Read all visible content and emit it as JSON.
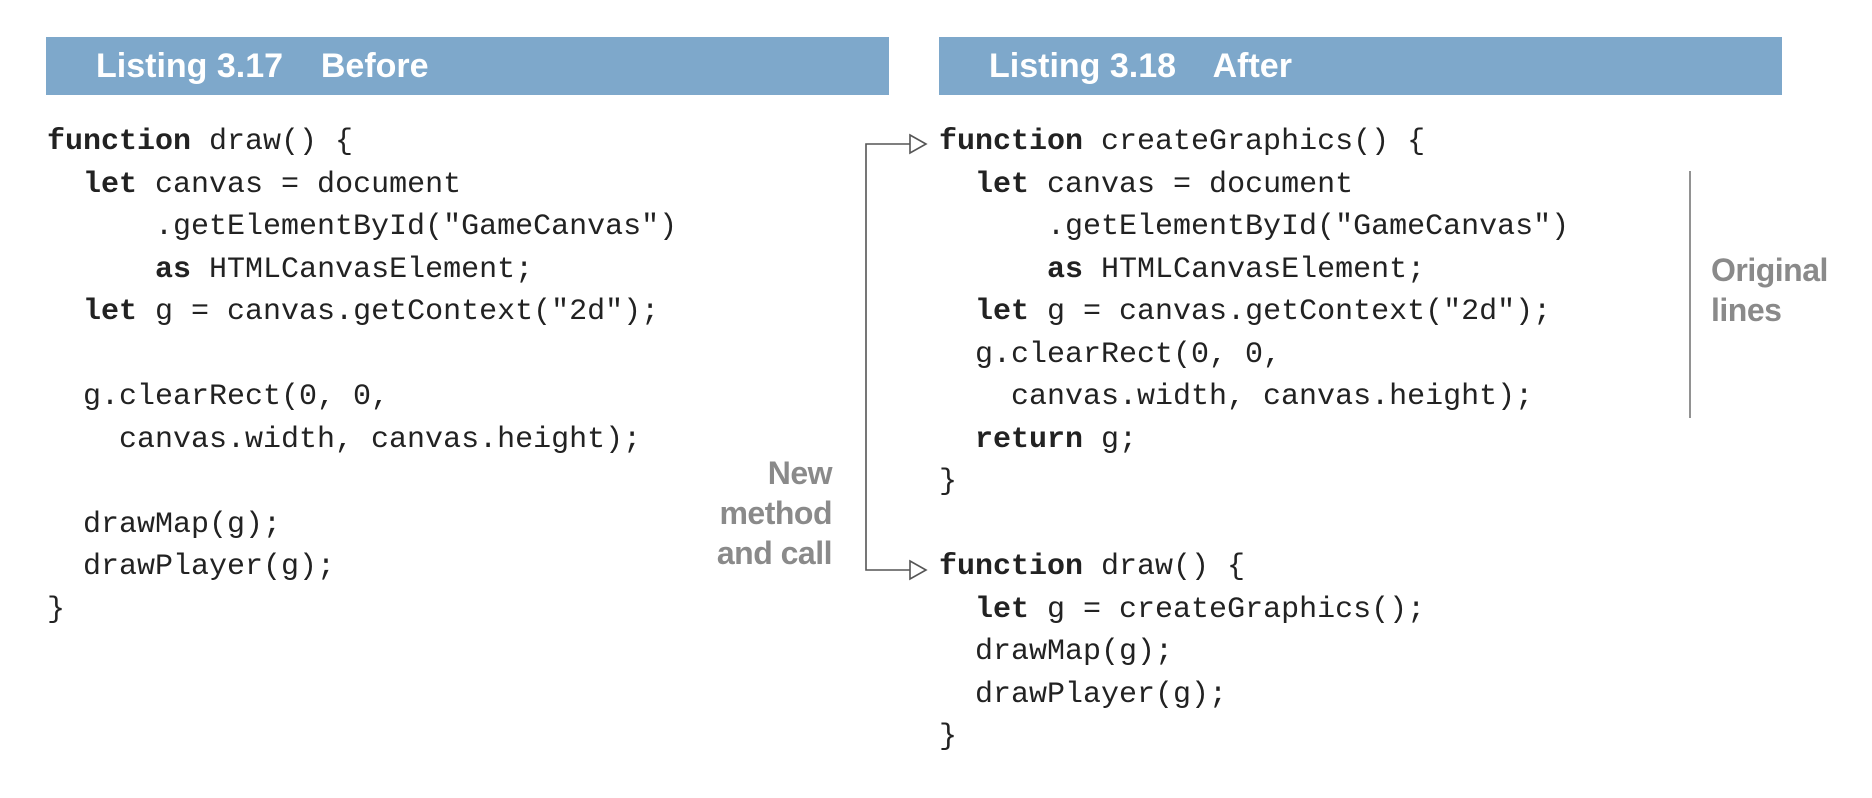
{
  "listings": {
    "before": {
      "number": "Listing 3.17",
      "title": "Before",
      "code_lines": [
        [
          {
            "t": "function",
            "kw": true
          },
          {
            "t": " draw() {"
          }
        ],
        [
          {
            "t": "  "
          },
          {
            "t": "let",
            "kw": true
          },
          {
            "t": " canvas = document"
          }
        ],
        [
          {
            "t": "      .getElementById(\"GameCanvas\")"
          }
        ],
        [
          {
            "t": "      "
          },
          {
            "t": "as",
            "kw": true
          },
          {
            "t": " HTMLCanvasElement;"
          }
        ],
        [
          {
            "t": "  "
          },
          {
            "t": "let",
            "kw": true
          },
          {
            "t": " g = canvas.getContext(\"2d\");"
          }
        ],
        [
          {
            "t": ""
          }
        ],
        [
          {
            "t": "  g.clearRect(0, 0,"
          }
        ],
        [
          {
            "t": "    canvas.width, canvas.height);"
          }
        ],
        [
          {
            "t": ""
          }
        ],
        [
          {
            "t": "  drawMap(g);"
          }
        ],
        [
          {
            "t": "  drawPlayer(g);"
          }
        ],
        [
          {
            "t": "}"
          }
        ]
      ]
    },
    "after": {
      "number": "Listing 3.18",
      "title": "After",
      "code_lines": [
        [
          {
            "t": "function",
            "kw": true
          },
          {
            "t": " createGraphics() {"
          }
        ],
        [
          {
            "t": "  "
          },
          {
            "t": "let",
            "kw": true
          },
          {
            "t": " canvas = document"
          }
        ],
        [
          {
            "t": "      .getElementById(\"GameCanvas\")"
          }
        ],
        [
          {
            "t": "      "
          },
          {
            "t": "as",
            "kw": true
          },
          {
            "t": " HTMLCanvasElement;"
          }
        ],
        [
          {
            "t": "  "
          },
          {
            "t": "let",
            "kw": true
          },
          {
            "t": " g = canvas.getContext(\"2d\");"
          }
        ],
        [
          {
            "t": "  g.clearRect(0, 0,"
          }
        ],
        [
          {
            "t": "    canvas.width, canvas.height);"
          }
        ],
        [
          {
            "t": "  "
          },
          {
            "t": "return",
            "kw": true
          },
          {
            "t": " g;"
          }
        ],
        [
          {
            "t": "}"
          }
        ],
        [
          {
            "t": ""
          }
        ],
        [
          {
            "t": "function",
            "kw": true
          },
          {
            "t": " draw() {"
          }
        ],
        [
          {
            "t": "  "
          },
          {
            "t": "let",
            "kw": true
          },
          {
            "t": " g = createGraphics();"
          }
        ],
        [
          {
            "t": "  drawMap(g);"
          }
        ],
        [
          {
            "t": "  drawPlayer(g);"
          }
        ],
        [
          {
            "t": "}"
          }
        ]
      ]
    }
  },
  "annotations": {
    "new_method": [
      "New",
      "method",
      "and call"
    ],
    "original_lines": [
      "Original",
      "lines"
    ]
  },
  "colors": {
    "header_background": "#7ea8cb",
    "header_text": "#ffffff",
    "code_text": "#222222",
    "annotation_text": "#8a8a8a",
    "connector_line": "#555555"
  }
}
